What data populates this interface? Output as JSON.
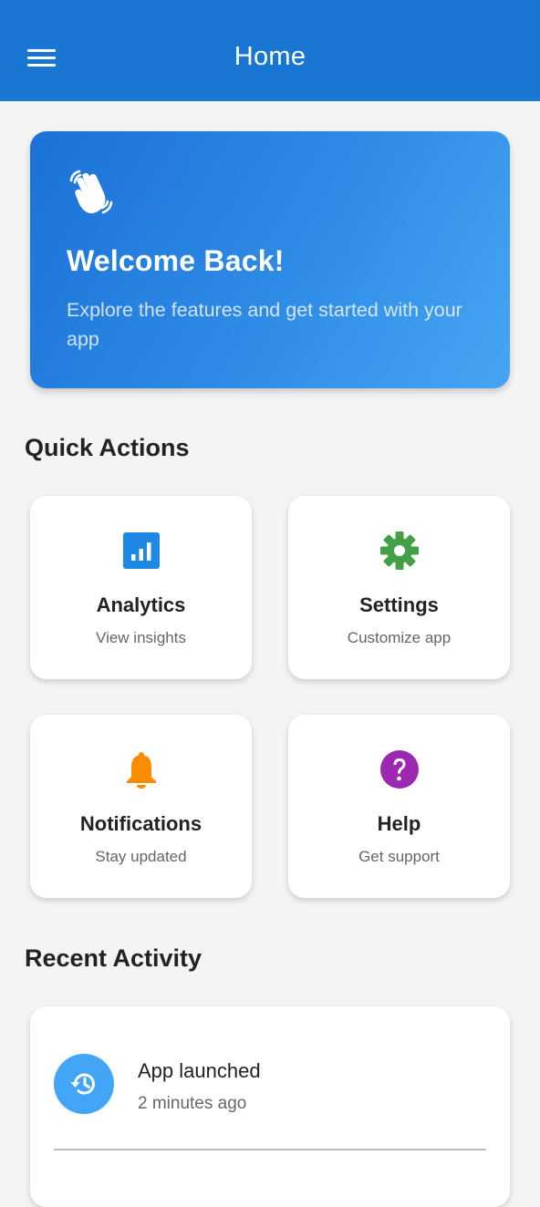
{
  "appbar": {
    "title": "Home",
    "menu_icon": "hamburger-menu-icon"
  },
  "welcome": {
    "icon": "waving-hand-icon",
    "title": "Welcome Back!",
    "subtitle": "Explore the features and get started with your app"
  },
  "quick_actions": {
    "heading": "Quick Actions",
    "items": [
      {
        "title": "Analytics",
        "subtitle": "View insights",
        "icon": "analytics-icon",
        "color": "#1e88e5"
      },
      {
        "title": "Settings",
        "subtitle": "Customize app",
        "icon": "gear-icon",
        "color": "#43a047"
      },
      {
        "title": "Notifications",
        "subtitle": "Stay updated",
        "icon": "bell-icon",
        "color": "#fb8c00"
      },
      {
        "title": "Help",
        "subtitle": "Get support",
        "icon": "help-icon",
        "color": "#9c27b0"
      }
    ]
  },
  "recent_activity": {
    "heading": "Recent Activity",
    "items": [
      {
        "title": "App launched",
        "time": "2 minutes ago",
        "icon": "history-icon"
      }
    ]
  },
  "colors": {
    "primary": "#1976d2",
    "background": "#f4f4f4",
    "avatar": "#42a5f5"
  }
}
